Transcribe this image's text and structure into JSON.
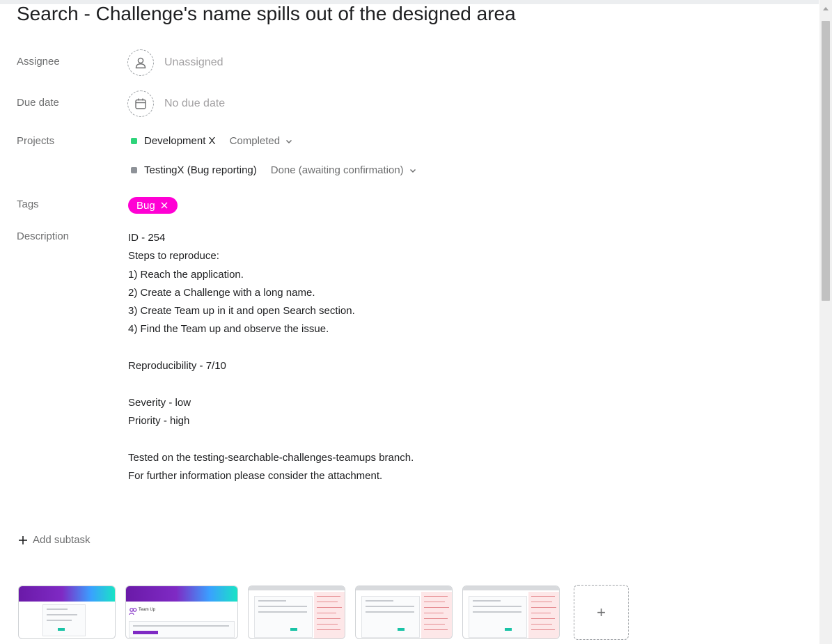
{
  "title": "Search - Challenge's name spills out of the designed area",
  "fields": {
    "assignee": {
      "label": "Assignee",
      "value": "Unassigned",
      "icon": "user-icon"
    },
    "due_date": {
      "label": "Due date",
      "value": "No due date",
      "icon": "calendar-icon"
    },
    "projects": {
      "label": "Projects",
      "items": [
        {
          "name": "Development X",
          "status": "Completed",
          "color": "#2ed47a"
        },
        {
          "name": "TestingX (Bug reporting)",
          "status": "Done (awaiting confirmation)",
          "color": "#8e9298"
        }
      ]
    },
    "tags": {
      "label": "Tags",
      "items": [
        {
          "name": "Bug",
          "color": "#ff00d4"
        }
      ]
    },
    "description": {
      "label": "Description",
      "lines": [
        "ID - 254",
        "Steps to reproduce:",
        "1) Reach the application.",
        "2) Create a Challenge with a long name.",
        "3) Create Team up in it and open Search section.",
        "4) Find the Team up and observe the issue.",
        "",
        "Reproducibility - 7/10",
        "",
        "Severity - low",
        "Priority - high",
        "",
        "Tested on the testing-searchable-challenges-teamups branch.",
        "For further information please consider the attachment."
      ]
    }
  },
  "add_subtask_label": "Add subtask",
  "attachments": {
    "thumb2_caption": "Team Up",
    "add_symbol": "+"
  }
}
